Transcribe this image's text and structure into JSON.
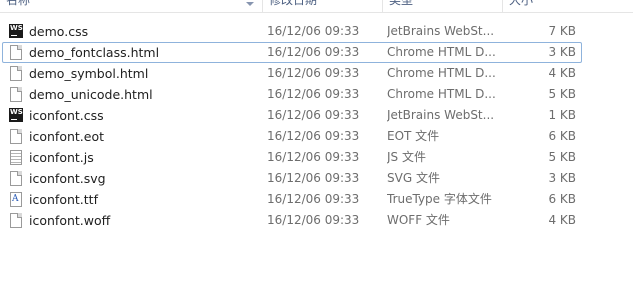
{
  "header": {
    "name": "名称",
    "date": "修改日期",
    "type": "类型",
    "size": "大小"
  },
  "files": [
    {
      "name": "demo.css",
      "date": "16/12/06 09:33",
      "type": "JetBrains WebSt...",
      "size": "7 KB",
      "icon": "webstorm-icon"
    },
    {
      "name": "demo_fontclass.html",
      "date": "16/12/06 09:33",
      "type": "Chrome HTML D...",
      "size": "3 KB",
      "icon": "html-file-icon"
    },
    {
      "name": "demo_symbol.html",
      "date": "16/12/06 09:33",
      "type": "Chrome HTML D...",
      "size": "4 KB",
      "icon": "html-file-icon"
    },
    {
      "name": "demo_unicode.html",
      "date": "16/12/06 09:33",
      "type": "Chrome HTML D...",
      "size": "5 KB",
      "icon": "html-file-icon"
    },
    {
      "name": "iconfont.css",
      "date": "16/12/06 09:33",
      "type": "JetBrains WebSt...",
      "size": "1 KB",
      "icon": "webstorm-icon"
    },
    {
      "name": "iconfont.eot",
      "date": "16/12/06 09:33",
      "type": "EOT 文件",
      "size": "6 KB",
      "icon": "generic-file-icon"
    },
    {
      "name": "iconfont.js",
      "date": "16/12/06 09:33",
      "type": "JS 文件",
      "size": "5 KB",
      "icon": "text-file-icon"
    },
    {
      "name": "iconfont.svg",
      "date": "16/12/06 09:33",
      "type": "SVG 文件",
      "size": "3 KB",
      "icon": "generic-file-icon"
    },
    {
      "name": "iconfont.ttf",
      "date": "16/12/06 09:33",
      "type": "TrueType 字体文件",
      "size": "6 KB",
      "icon": "truetype-font-icon"
    },
    {
      "name": "iconfont.woff",
      "date": "16/12/06 09:33",
      "type": "WOFF 文件",
      "size": "4 KB",
      "icon": "generic-file-icon"
    }
  ],
  "icon_glyphs": {
    "webstorm": "WS",
    "truetype": "A"
  },
  "colors": {
    "focus_border": "#8fb3dc",
    "meta_text": "#6d6d6d",
    "header_text": "#4d6082"
  }
}
